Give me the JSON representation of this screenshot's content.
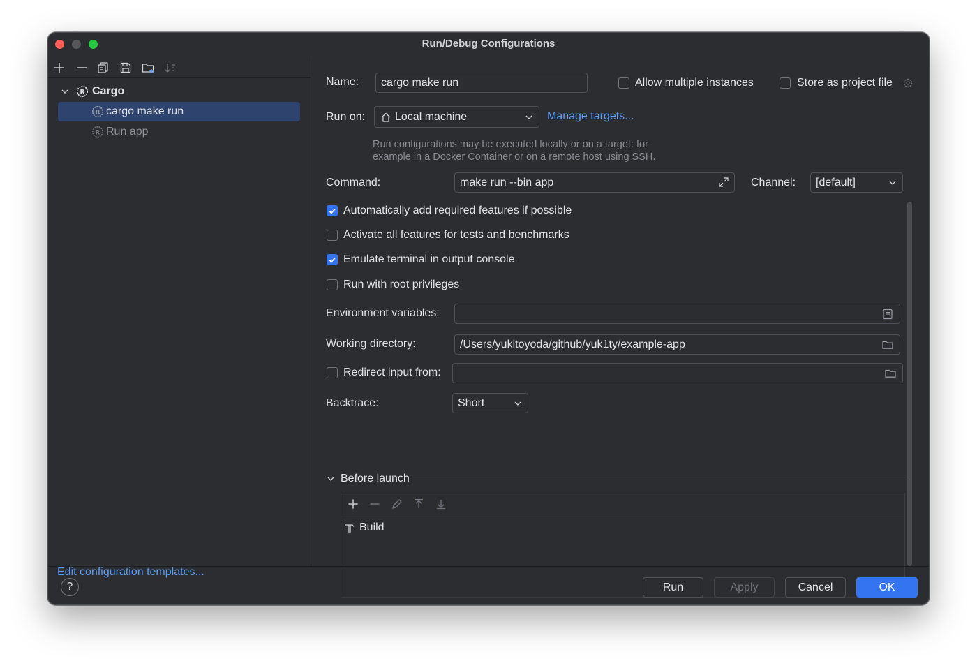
{
  "window": {
    "title": "Run/Debug Configurations"
  },
  "sidebar": {
    "toolbar": [
      {
        "icon": "plus-icon"
      },
      {
        "icon": "minus-icon"
      },
      {
        "icon": "copy-icon"
      },
      {
        "icon": "save-icon"
      },
      {
        "icon": "new-folder-icon"
      },
      {
        "icon": "sort-icon"
      }
    ],
    "tree": {
      "group_label": "Cargo",
      "items": [
        {
          "label": "cargo make run",
          "selected": true
        },
        {
          "label": "Run app",
          "selected": false
        }
      ]
    },
    "edit_templates_link": "Edit configuration templates..."
  },
  "form": {
    "name_label": "Name:",
    "name_value": "cargo make run",
    "allow_multiple_label": "Allow multiple instances",
    "allow_multiple_checked": false,
    "store_project_label": "Store as project file",
    "store_project_checked": false,
    "run_on_label": "Run on:",
    "run_on_value": "Local machine",
    "manage_targets_link": "Manage targets...",
    "hint_line1": "Run configurations may be executed locally or on a target: for",
    "hint_line2": "example in a Docker Container or on a remote host using SSH.",
    "command_label": "Command:",
    "command_value": "make run --bin app",
    "channel_label": "Channel:",
    "channel_value": "[default]",
    "checkboxes": [
      {
        "label": "Automatically add required features if possible",
        "checked": true
      },
      {
        "label": "Activate all features for tests and benchmarks",
        "checked": false
      },
      {
        "label": "Emulate terminal in output console",
        "checked": true
      },
      {
        "label": "Run with root privileges",
        "checked": false
      }
    ],
    "env_label": "Environment variables:",
    "env_value": "",
    "workdir_label": "Working directory:",
    "workdir_value": "/Users/yukitoyoda/github/yuk1ty/example-app",
    "redirect_label": "Redirect input from:",
    "redirect_checked": false,
    "redirect_value": "",
    "backtrace_label": "Backtrace:",
    "backtrace_value": "Short"
  },
  "before_launch": {
    "title": "Before launch",
    "tasks": [
      {
        "label": "Build",
        "icon": "hammer-icon"
      }
    ]
  },
  "footer": {
    "help_label": "?",
    "run_label": "Run",
    "apply_label": "Apply",
    "cancel_label": "Cancel",
    "ok_label": "OK"
  },
  "colors": {
    "accent": "#3574f0",
    "link": "#5b9cf5",
    "background": "#2b2d30",
    "selection": "#2e436e"
  }
}
